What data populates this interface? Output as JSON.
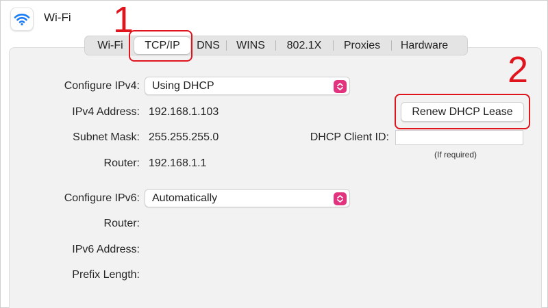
{
  "window": {
    "title": "Wi-Fi",
    "icon": "wifi-icon"
  },
  "tabs": [
    {
      "label": "Wi-Fi",
      "active": false
    },
    {
      "label": "TCP/IP",
      "active": true
    },
    {
      "label": "DNS",
      "active": false
    },
    {
      "label": "WINS",
      "active": false
    },
    {
      "label": "802.1X",
      "active": false
    },
    {
      "label": "Proxies",
      "active": false
    },
    {
      "label": "Hardware",
      "active": false
    }
  ],
  "annotations": {
    "step1": "1",
    "step2": "2",
    "color": "#e0141d"
  },
  "ipv4": {
    "configure_label": "Configure IPv4:",
    "configure_value": "Using DHCP",
    "address_label": "IPv4 Address:",
    "address_value": "192.168.1.103",
    "subnet_label": "Subnet Mask:",
    "subnet_value": "255.255.255.0",
    "router_label": "Router:",
    "router_value": "192.168.1.1"
  },
  "dhcp": {
    "renew_button": "Renew DHCP Lease",
    "client_id_label": "DHCP Client ID:",
    "client_id_value": "",
    "client_id_hint": "(If required)"
  },
  "ipv6": {
    "configure_label": "Configure IPv6:",
    "configure_value": "Automatically",
    "router_label": "Router:",
    "address_label": "IPv6 Address:",
    "prefix_label": "Prefix Length:"
  },
  "colors": {
    "stepper": "#e2337f",
    "panel": "#f2f2f2",
    "annotation": "#e0141d"
  }
}
